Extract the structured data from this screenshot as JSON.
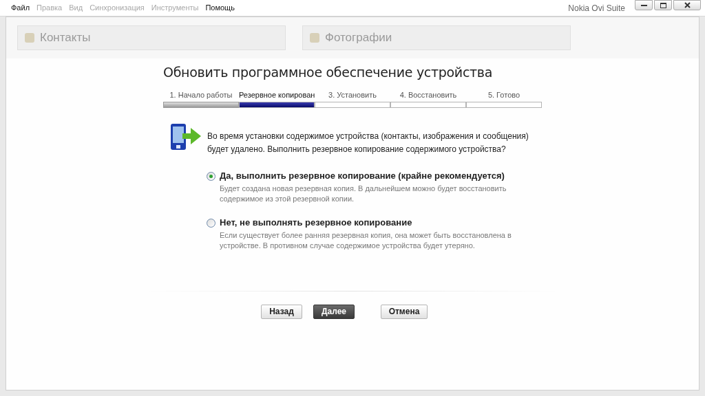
{
  "menu": [
    {
      "label": "Файл",
      "disabled": false
    },
    {
      "label": "Правка",
      "disabled": true
    },
    {
      "label": "Вид",
      "disabled": true
    },
    {
      "label": "Синхронизация",
      "disabled": true
    },
    {
      "label": "Инструменты",
      "disabled": true
    },
    {
      "label": "Помощь",
      "disabled": false
    }
  ],
  "window": {
    "title": "Nokia Ovi Suite"
  },
  "background_panels": [
    {
      "title": "Контакты"
    },
    {
      "title": "Фотографии"
    }
  ],
  "dialog": {
    "title": "Обновить программное обеспечение устройства",
    "steps": [
      {
        "label": "1. Начало работы",
        "completed": true,
        "selected": false
      },
      {
        "label": "Резервное копирован",
        "completed": false,
        "selected": true
      },
      {
        "label": "3. Установить",
        "completed": false,
        "selected": false
      },
      {
        "label": "4. Восстановить",
        "completed": false,
        "selected": false
      },
      {
        "label": "5. Готово",
        "completed": false,
        "selected": false
      }
    ],
    "message": "Во время установки содержимое устройства (контакты, изображения и сообщения) будет удалено. Выполнить резервное копирование содержимого устройства?",
    "options": [
      {
        "label": "Да, выполнить резервное копирование (крайне рекомендуется)",
        "description": "Будет создана новая резервная копия. В дальнейшем можно будет восстановить содержимое из этой резервной копии.",
        "selected": true
      },
      {
        "label": "Нет, не выполнять резервное копирование",
        "description": "Если существует более ранняя резервная копия, она может быть восстановлена в устройстве. В противном случае содержимое устройства будет утеряно.",
        "selected": false
      }
    ],
    "buttons": [
      {
        "label": "Назад",
        "kind": "normal"
      },
      {
        "label": "Далее",
        "kind": "primary"
      },
      {
        "label": "Отмена",
        "kind": "normal"
      }
    ]
  }
}
